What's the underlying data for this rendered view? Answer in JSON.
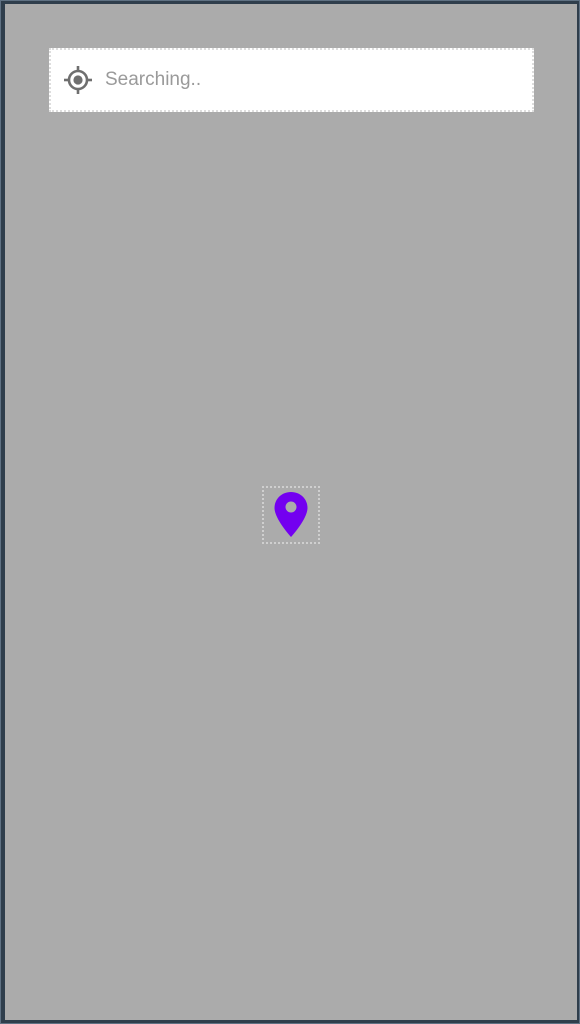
{
  "search": {
    "placeholder": "Searching..",
    "value": ""
  },
  "icons": {
    "locate": "my-location-icon",
    "marker": "map-pin-icon"
  },
  "colors": {
    "map_background": "#ababab",
    "pin": "#7300f0",
    "locate_icon": "#6f6f6f"
  }
}
